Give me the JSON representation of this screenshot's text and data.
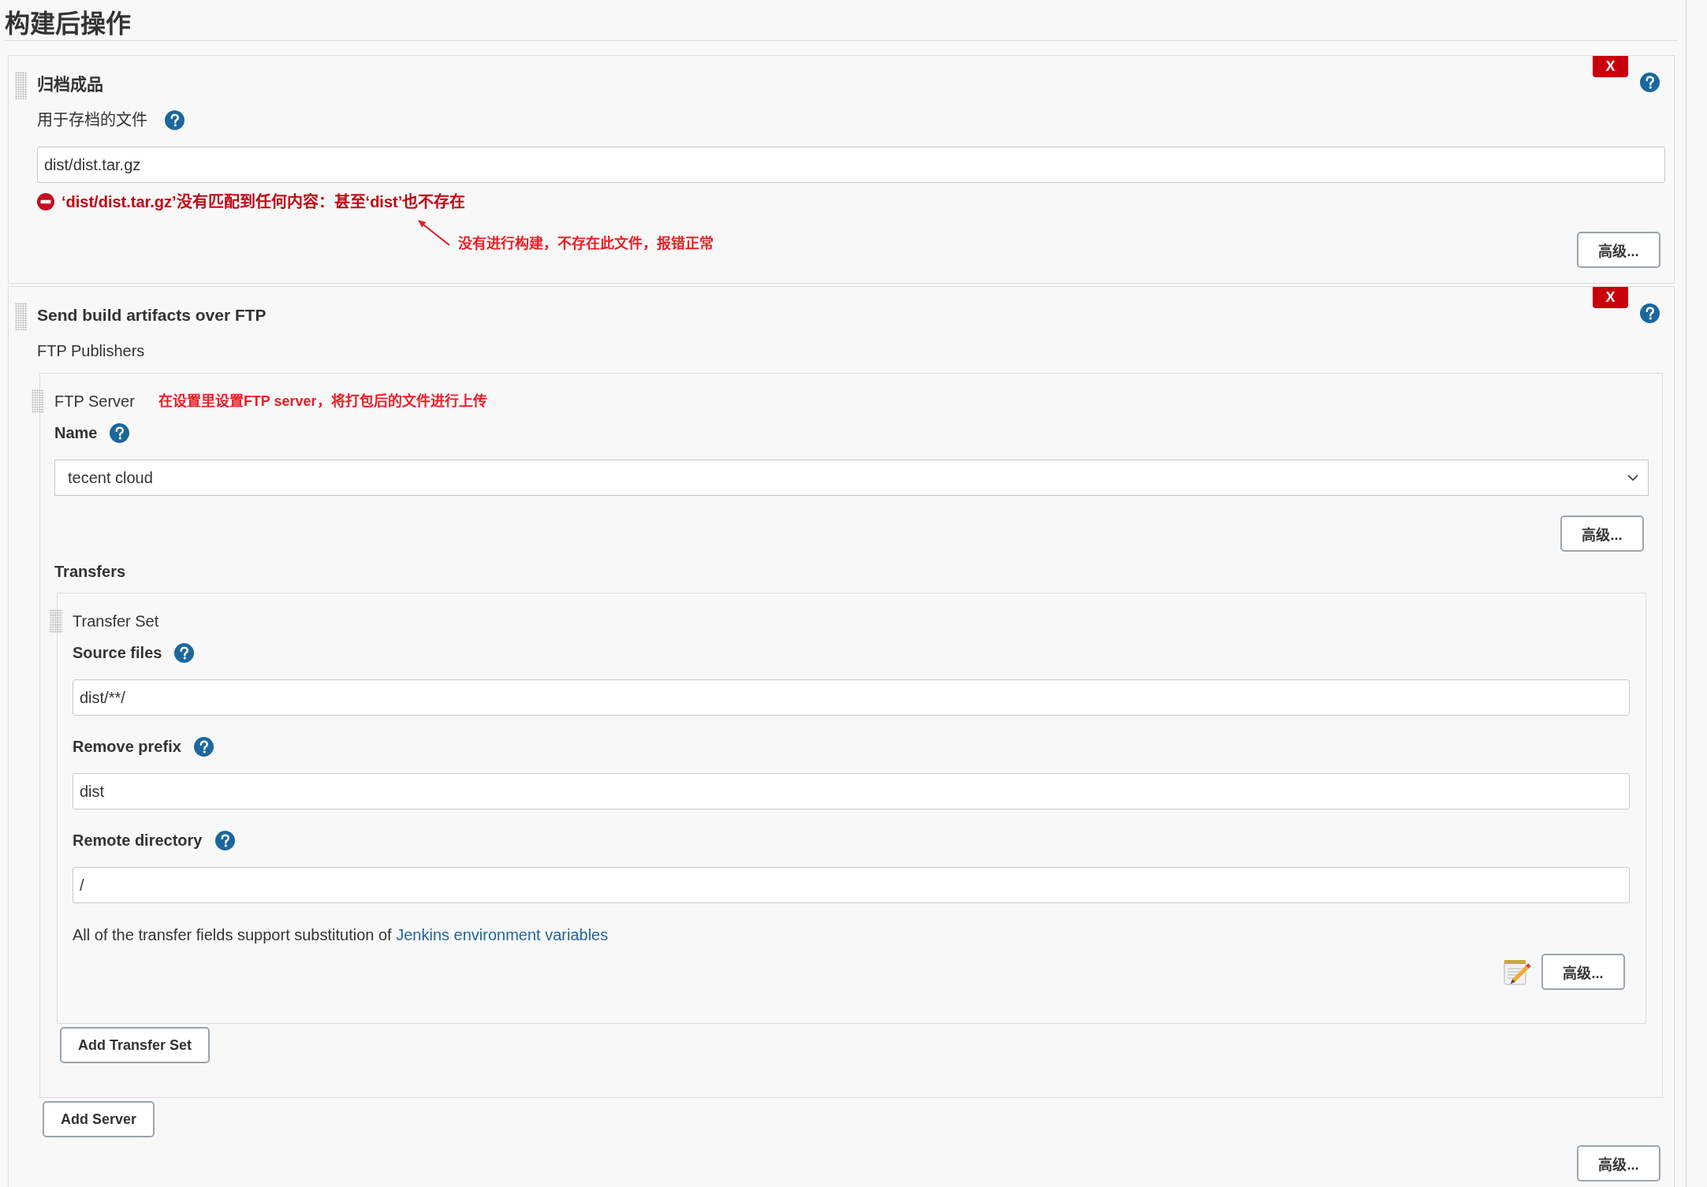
{
  "heading": "构建后操作",
  "steps": [
    {
      "title": "归档成品",
      "delete_button": "X",
      "fields": [
        {
          "kind": "text",
          "label": "用于存档的文件",
          "value": "dist/dist.tar.gz",
          "error": "‘dist/dist.tar.gz’没有匹配到任何内容：甚至‘dist’也不存在"
        }
      ],
      "annotation": "没有进行构建，不存在此文件，报错正常",
      "advanced_button": "高级..."
    },
    {
      "title": "Send build artifacts over FTP",
      "delete_button": "X",
      "publishers_label": "FTP Publishers",
      "servers": [
        {
          "title": "FTP Server",
          "annotation": "在设置里设置FTP server，将打包后的文件进行上传",
          "fields": [
            {
              "kind": "select",
              "label": "Name",
              "value": "tecent cloud"
            }
          ],
          "advanced_button": "高级...",
          "transfers_label": "Transfers",
          "transfer_sets": [
            {
              "title": "Transfer Set",
              "fields": [
                {
                  "kind": "text",
                  "label": "Source files",
                  "value": "dist/**/"
                },
                {
                  "kind": "text",
                  "label": "Remove prefix",
                  "value": "dist"
                },
                {
                  "kind": "text",
                  "label": "Remote directory",
                  "value": "/"
                }
              ],
              "note": {
                "text": "All of the transfer fields support substitution of",
                "link": "Jenkins environment variables"
              },
              "advanced_button": "高级..."
            }
          ],
          "add_transfer_set_button": "Add Transfer Set"
        }
      ],
      "add_server_button": "Add Server",
      "advanced_button": "高级..."
    }
  ]
}
